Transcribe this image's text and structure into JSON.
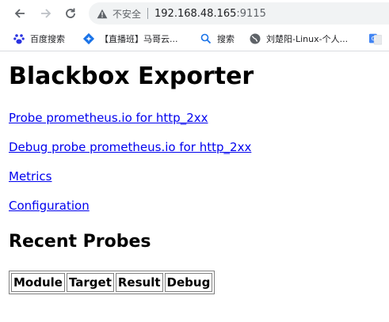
{
  "browser": {
    "back_icon": "arrow-left-icon",
    "forward_icon": "arrow-right-icon",
    "reload_icon": "reload-icon",
    "security_label": "不安全",
    "url_host": "192.168.48.165",
    "url_port": ":9115"
  },
  "bookmarks": [
    {
      "label": "百度搜索",
      "icon": "baidu-paw-icon"
    },
    {
      "label": "【直播班】马哥云...",
      "icon": "bookmark-diamond-icon"
    },
    {
      "label": "搜索",
      "icon": "search-icon"
    },
    {
      "label": "刘楚阳-Linux-个人...",
      "icon": "globe-icon"
    },
    {
      "label": "",
      "icon": "google-translate-icon"
    }
  ],
  "page": {
    "title": "Blackbox Exporter",
    "links": [
      "Probe prometheus.io for http_2xx",
      "Debug probe prometheus.io for http_2xx",
      "Metrics",
      "Configuration"
    ],
    "recent_heading": "Recent Probes",
    "table_headers": [
      "Module",
      "Target",
      "Result",
      "Debug"
    ]
  }
}
